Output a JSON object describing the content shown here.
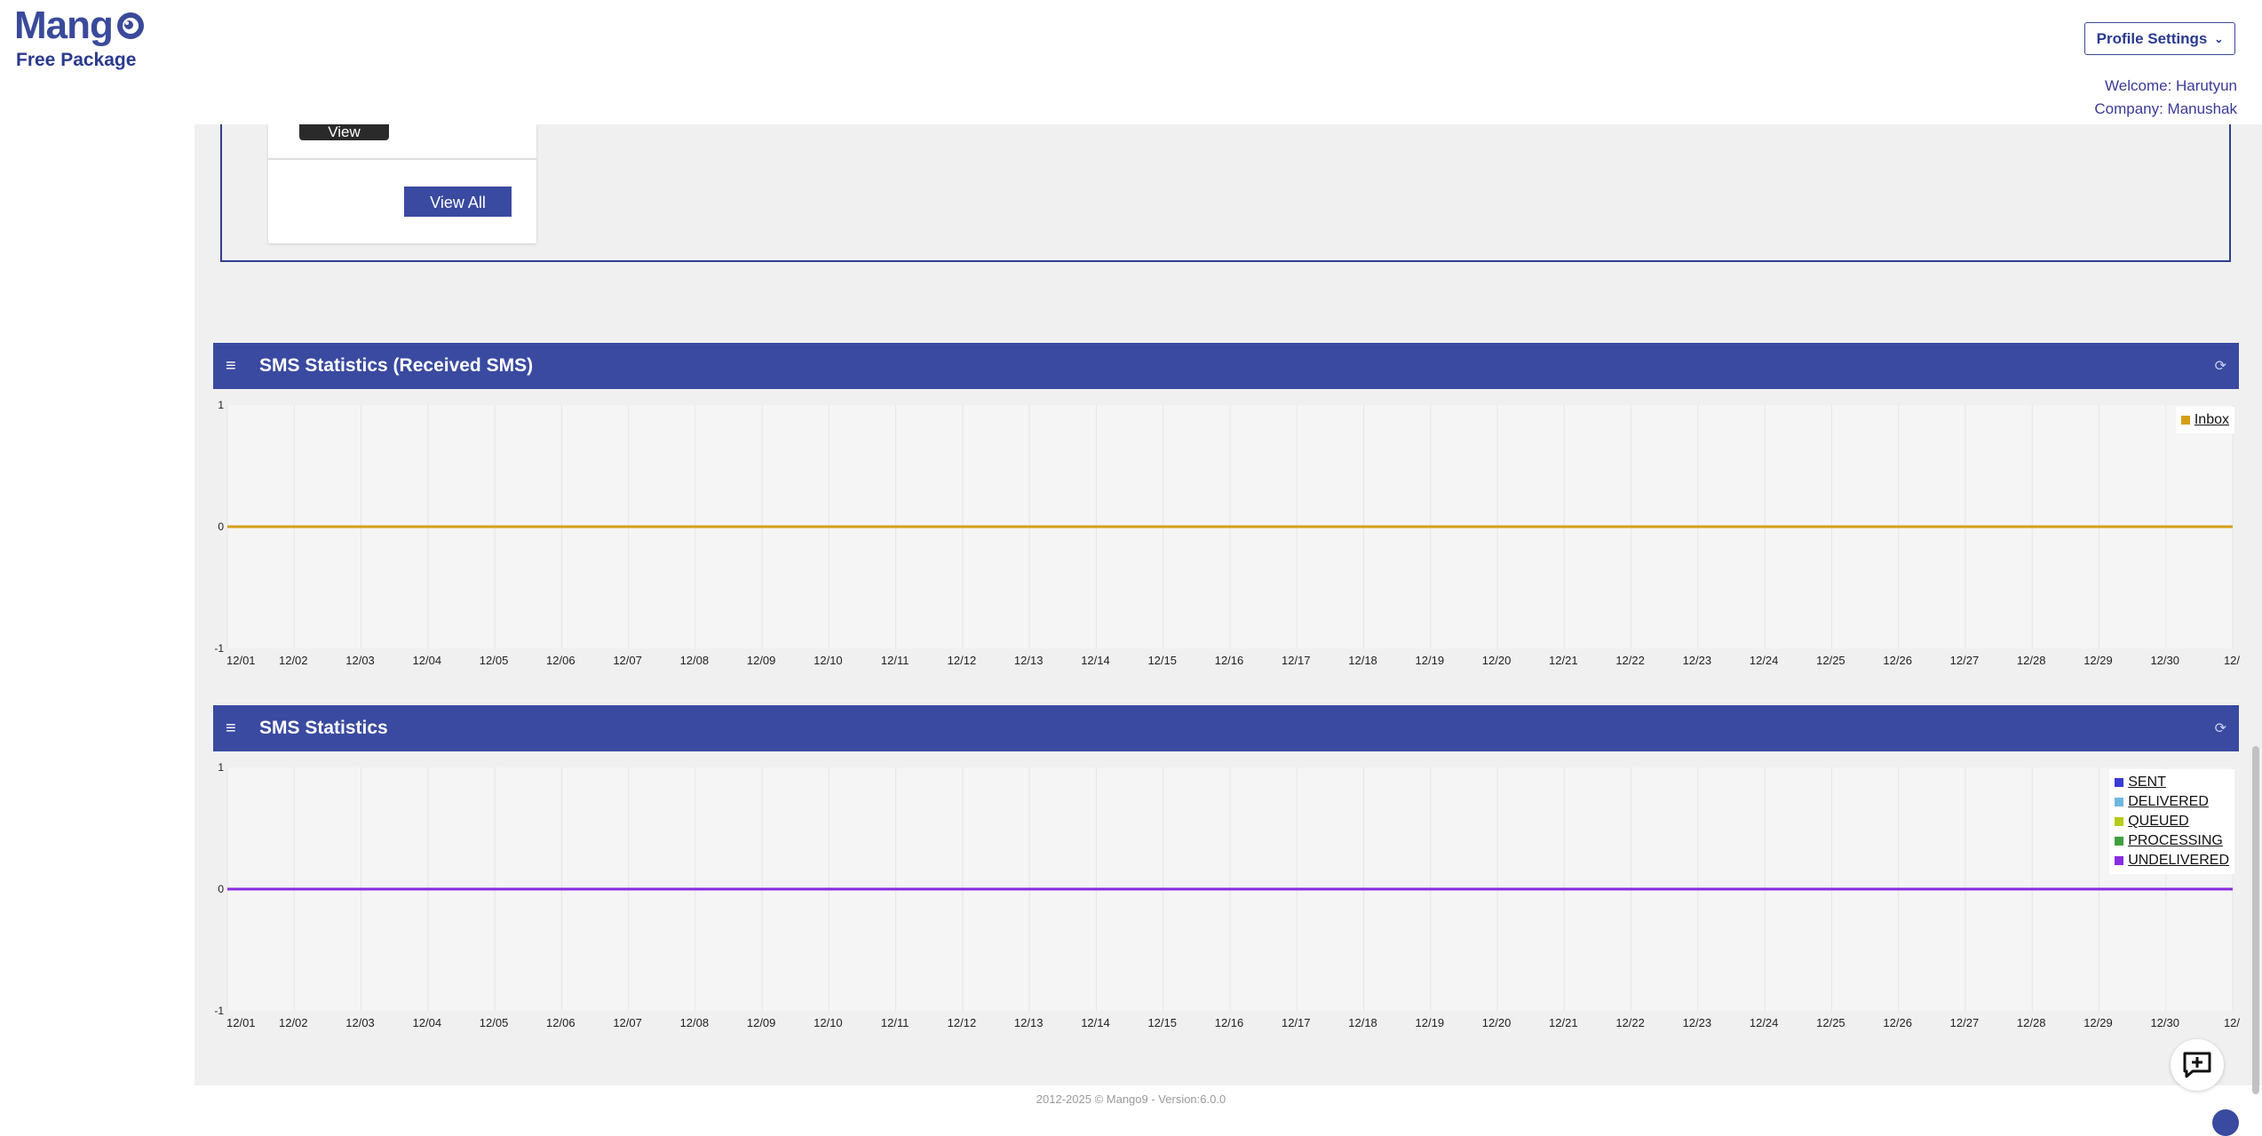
{
  "header": {
    "logo_text": "Mang",
    "package": "Free Package",
    "profile_button": "Profile Settings",
    "welcome": "Welcome: Harutyun",
    "company": "Company: Manushak"
  },
  "card": {
    "view_label": "View",
    "view_all_label": "View All"
  },
  "panels": {
    "received": {
      "title": "SMS Statistics (Received SMS)",
      "icons": {
        "menu": "menu-icon",
        "refresh": "refresh-icon"
      }
    },
    "stats": {
      "title": "SMS Statistics",
      "icons": {
        "menu": "menu-icon",
        "refresh": "refresh-icon"
      }
    }
  },
  "chart_data": [
    {
      "type": "line",
      "title": "SMS Statistics (Received SMS)",
      "x": [
        "12/01",
        "12/02",
        "12/03",
        "12/04",
        "12/05",
        "12/06",
        "12/07",
        "12/08",
        "12/09",
        "12/10",
        "12/11",
        "12/12",
        "12/13",
        "12/14",
        "12/15",
        "12/16",
        "12/17",
        "12/18",
        "12/19",
        "12/20",
        "12/21",
        "12/22",
        "12/23",
        "12/24",
        "12/25",
        "12/26",
        "12/27",
        "12/28",
        "12/29",
        "12/30",
        "12/"
      ],
      "ylim": [
        -1,
        1
      ],
      "yticks": [
        "1",
        "0",
        "-1"
      ],
      "legend_position": "top-right",
      "grid": true,
      "series": [
        {
          "name": "Inbox",
          "color": "#d4a017",
          "values": [
            0,
            0,
            0,
            0,
            0,
            0,
            0,
            0,
            0,
            0,
            0,
            0,
            0,
            0,
            0,
            0,
            0,
            0,
            0,
            0,
            0,
            0,
            0,
            0,
            0,
            0,
            0,
            0,
            0,
            0,
            0
          ]
        }
      ]
    },
    {
      "type": "line",
      "title": "SMS Statistics",
      "x": [
        "12/01",
        "12/02",
        "12/03",
        "12/04",
        "12/05",
        "12/06",
        "12/07",
        "12/08",
        "12/09",
        "12/10",
        "12/11",
        "12/12",
        "12/13",
        "12/14",
        "12/15",
        "12/16",
        "12/17",
        "12/18",
        "12/19",
        "12/20",
        "12/21",
        "12/22",
        "12/23",
        "12/24",
        "12/25",
        "12/26",
        "12/27",
        "12/28",
        "12/29",
        "12/30",
        "12/"
      ],
      "ylim": [
        -1,
        1
      ],
      "yticks": [
        "1",
        "0",
        "-1"
      ],
      "legend_position": "top-right",
      "grid": true,
      "series": [
        {
          "name": "SENT",
          "color": "#3b3bd6",
          "values": [
            0,
            0,
            0,
            0,
            0,
            0,
            0,
            0,
            0,
            0,
            0,
            0,
            0,
            0,
            0,
            0,
            0,
            0,
            0,
            0,
            0,
            0,
            0,
            0,
            0,
            0,
            0,
            0,
            0,
            0,
            0
          ]
        },
        {
          "name": "DELIVERED",
          "color": "#6fb7e0",
          "values": [
            0,
            0,
            0,
            0,
            0,
            0,
            0,
            0,
            0,
            0,
            0,
            0,
            0,
            0,
            0,
            0,
            0,
            0,
            0,
            0,
            0,
            0,
            0,
            0,
            0,
            0,
            0,
            0,
            0,
            0,
            0
          ]
        },
        {
          "name": "QUEUED",
          "color": "#b5cc18",
          "values": [
            0,
            0,
            0,
            0,
            0,
            0,
            0,
            0,
            0,
            0,
            0,
            0,
            0,
            0,
            0,
            0,
            0,
            0,
            0,
            0,
            0,
            0,
            0,
            0,
            0,
            0,
            0,
            0,
            0,
            0,
            0
          ]
        },
        {
          "name": "PROCESSING",
          "color": "#3f9f3f",
          "values": [
            0,
            0,
            0,
            0,
            0,
            0,
            0,
            0,
            0,
            0,
            0,
            0,
            0,
            0,
            0,
            0,
            0,
            0,
            0,
            0,
            0,
            0,
            0,
            0,
            0,
            0,
            0,
            0,
            0,
            0,
            0
          ]
        },
        {
          "name": "UNDELIVERED",
          "color": "#8a2be2",
          "values": [
            0,
            0,
            0,
            0,
            0,
            0,
            0,
            0,
            0,
            0,
            0,
            0,
            0,
            0,
            0,
            0,
            0,
            0,
            0,
            0,
            0,
            0,
            0,
            0,
            0,
            0,
            0,
            0,
            0,
            0,
            0
          ]
        }
      ]
    }
  ],
  "footer": {
    "text": "2012-2025 © Mango9 - Version:6.0.0"
  },
  "icons": {
    "chat": "chat-plus-icon",
    "chevron": "chevron-down-icon"
  }
}
